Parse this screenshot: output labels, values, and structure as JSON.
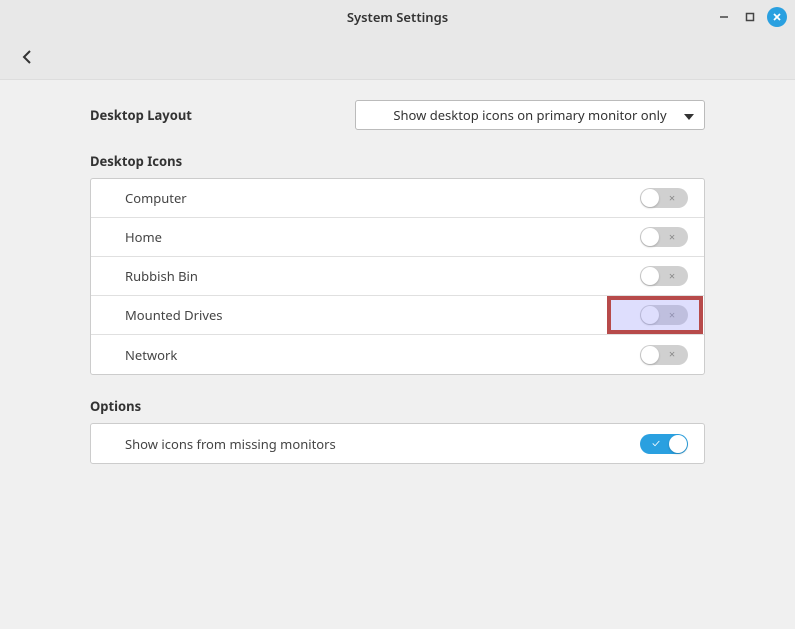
{
  "window": {
    "title": "System Settings"
  },
  "layout": {
    "label": "Desktop Layout",
    "select_value": "Show desktop icons on primary monitor only"
  },
  "icons_section": {
    "title": "Desktop Icons",
    "items": [
      {
        "label": "Computer",
        "on": false
      },
      {
        "label": "Home",
        "on": false
      },
      {
        "label": "Rubbish Bin",
        "on": false
      },
      {
        "label": "Mounted Drives",
        "on": false,
        "highlighted": true
      },
      {
        "label": "Network",
        "on": false
      }
    ]
  },
  "options_section": {
    "title": "Options",
    "items": [
      {
        "label": "Show icons from missing monitors",
        "on": true
      }
    ]
  }
}
